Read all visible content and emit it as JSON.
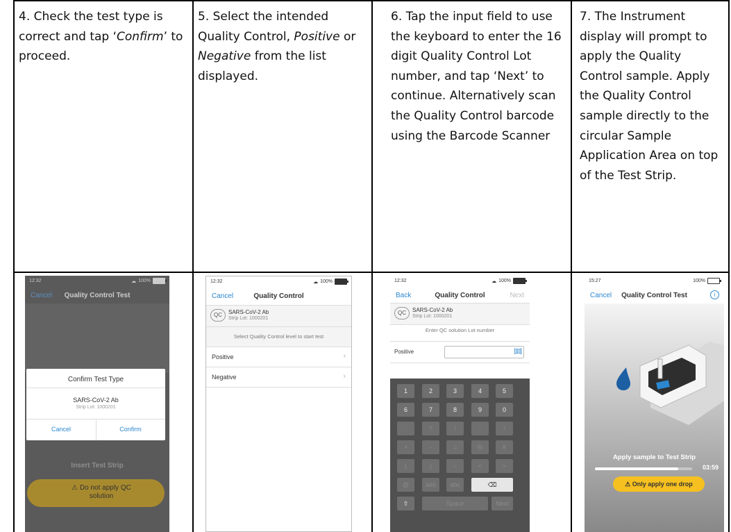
{
  "steps": [
    {
      "pre": "4. Check the test type is correct and tap ‘",
      "em": "Confirm",
      "post": "’ to proceed."
    },
    {
      "pre": "5. Select the intended Quality Control, ",
      "em1": "Positive",
      "mid": " or ",
      "em2": "Negative",
      "post": " from the list displayed."
    },
    {
      "text": "6. Tap the input field to use the keyboard to enter the 16 digit Quality Control Lot number, and tap ‘Next’ to continue. Alternatively scan the Quality Control barcode using the Barcode Scanner"
    },
    {
      "text": "7. The Instrument display will prompt to apply the Quality Control sample. Apply the Quality Control sample directly to the circular Sample Application Area on top of the Test Strip."
    }
  ],
  "screen1": {
    "time": "12:32",
    "battery": "100%",
    "cancel": "Cancel",
    "title": "Quality Control Test",
    "dialog_title": "Confirm Test Type",
    "test_name": "SARS-CoV-2 Ab",
    "strip_lot": "Strip Lot: 1000201",
    "cancel_btn": "Cancel",
    "confirm_btn": "Confirm",
    "insert": "Insert Test Strip",
    "warning": "Do not apply QC solution"
  },
  "screen2": {
    "time": "12:32",
    "battery": "100%",
    "cancel": "Cancel",
    "title": "Quality Control",
    "qc": "QC",
    "test_name": "SARS-CoV-2 Ab",
    "strip_lot": "Strip Lot: 1000201",
    "prompt": "Select Quality Control level to start test",
    "options": [
      "Positive",
      "Negative"
    ]
  },
  "screen3": {
    "time": "12:32",
    "battery": "100%",
    "back": "Back",
    "title": "Quality Control",
    "next": "Next",
    "qc": "QC",
    "test_name": "SARS-CoV-2 Ab",
    "strip_lot": "Strip Lot: 1000201",
    "prompt": "Enter QC solution Lot number",
    "field_label": "Positive",
    "keys": [
      [
        "1",
        "2",
        "3",
        "4",
        "5"
      ],
      [
        "6",
        "7",
        "8",
        "9",
        "0"
      ],
      [
        ".",
        "?",
        "!",
        "'",
        "/"
      ],
      [
        "+",
        "-",
        "=",
        "%",
        "#"
      ],
      [
        "(",
        ")",
        "–",
        "<",
        ">"
      ]
    ],
    "key_at": "@",
    "key_accent": "àéö",
    "key_abc": "abc",
    "key_space": "Space",
    "key_next": "Next"
  },
  "screen4": {
    "time": "15:27",
    "battery": "100%",
    "cancel": "Cancel",
    "title": "Quality Control Test",
    "instruction": "Apply sample to Test Strip",
    "countdown": "03:59",
    "progress": 0.86,
    "warning": "Only apply one drop"
  }
}
